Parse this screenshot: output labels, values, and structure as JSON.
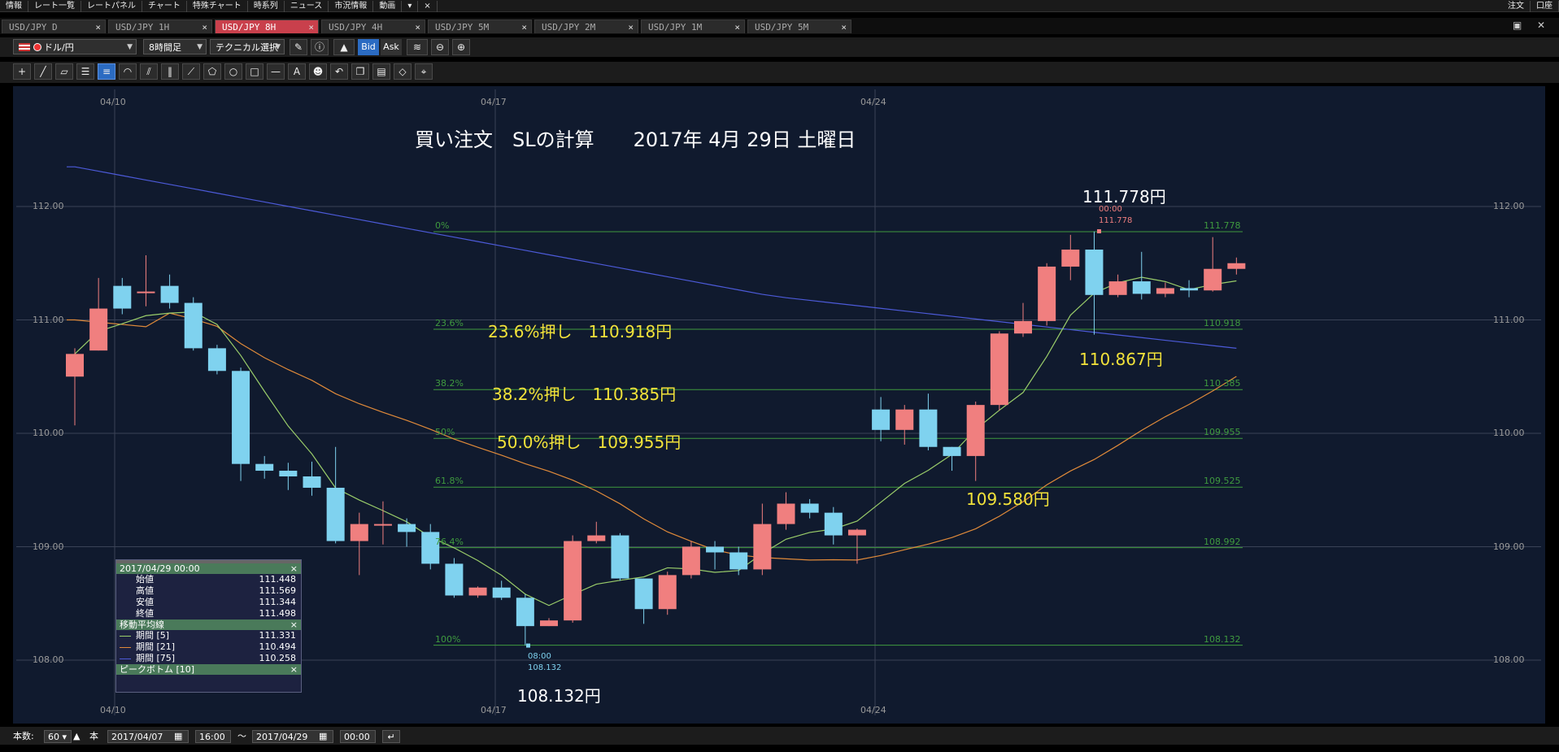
{
  "menu": {
    "items": [
      "情報",
      "レート一覧",
      "レートパネル",
      "チャート",
      "特殊チャート",
      "時系列",
      "ニュース",
      "市況情報",
      "動画"
    ],
    "more": "▾",
    "close": "×",
    "right_order": "注文",
    "right_account": "口座"
  },
  "tabs": [
    {
      "label": "USD/JPY D",
      "active": false
    },
    {
      "label": "USD/JPY 1H",
      "active": false
    },
    {
      "label": "USD/JPY 8H",
      "active": true
    },
    {
      "label": "USD/JPY 4H",
      "active": false
    },
    {
      "label": "USD/JPY 5M",
      "active": false
    },
    {
      "label": "USD/JPY 2M",
      "active": false
    },
    {
      "label": "USD/JPY 1M",
      "active": false
    },
    {
      "label": "USD/JPY 5M",
      "active": false
    }
  ],
  "tab_close": "×",
  "toolbar": {
    "pair": "ドル/円",
    "timeframe": "8時間足",
    "technical": "テクニカル選択",
    "bid": "Bid",
    "ask": "Ask"
  },
  "drawing_tools": [
    "cursor-cross",
    "trend-line",
    "ruler",
    "horizontal-lines",
    "channel",
    "fibonacci-arc",
    "fan",
    "vertical-lines",
    "gann",
    "pentagon",
    "circle",
    "rectangle",
    "horizontal-line",
    "text",
    "icon",
    "undo",
    "copy",
    "paste",
    "eraser",
    "measure"
  ],
  "chart": {
    "title": "買い注文　SLの計算　　2017年 4月 29日 土曜日",
    "y_axis_labels": [
      "112.00",
      "111.00",
      "110.00",
      "109.00",
      "108.00"
    ],
    "x_axis_labels": [
      "04/10",
      "04/17",
      "04/24"
    ],
    "fib_levels": [
      {
        "pct": "0%",
        "value": "111.778"
      },
      {
        "pct": "23.6%",
        "value": "110.918"
      },
      {
        "pct": "38.2%",
        "value": "110.385"
      },
      {
        "pct": "50%",
        "value": "109.955"
      },
      {
        "pct": "61.8%",
        "value": "109.525"
      },
      {
        "pct": "76.4%",
        "value": "108.992"
      },
      {
        "pct": "100%",
        "value": "108.132"
      }
    ],
    "annotations": {
      "fib236": "23.6%押し　110.918円",
      "fib382": "38.2%押し　110.385円",
      "fib500": "50.0%押し　109.955円",
      "high": "111.778円",
      "low": "108.132円",
      "a110867": "110.867円",
      "a109580": "109.580円"
    },
    "peak_marker": {
      "time": "00:00",
      "value": "111.778"
    },
    "bottom_marker": {
      "time": "08:00",
      "value": "108.132"
    },
    "colors": {
      "up": "#f07f7f",
      "down": "#7fd2ef",
      "ma5": "#9acd6a",
      "ma21": "#e08a3a",
      "ma75": "#4c5ad8",
      "fib": "#3f9a3f",
      "background": "#101a2e"
    }
  },
  "chart_data": {
    "type": "candlestick",
    "timeframe": "8H",
    "x_range": [
      "04/10",
      "04/28"
    ],
    "ylim": [
      107.75,
      112.75
    ],
    "candles": [
      [
        110.5,
        110.7,
        110.07,
        110.75
      ],
      [
        110.73,
        111.1,
        110.73,
        111.37
      ],
      [
        111.3,
        111.1,
        111.05,
        111.37
      ],
      [
        111.25,
        111.25,
        111.12,
        111.57
      ],
      [
        111.3,
        111.15,
        111.1,
        111.4
      ],
      [
        111.15,
        110.75,
        110.73,
        111.2
      ],
      [
        110.75,
        110.55,
        110.52,
        110.78
      ],
      [
        110.55,
        109.73,
        109.58,
        110.58
      ],
      [
        109.73,
        109.67,
        109.6,
        109.8
      ],
      [
        109.67,
        109.62,
        109.5,
        109.74
      ],
      [
        109.62,
        109.52,
        109.45,
        109.75
      ],
      [
        109.52,
        109.05,
        109.03,
        109.88
      ],
      [
        109.05,
        109.2,
        108.75,
        109.3
      ],
      [
        109.2,
        109.2,
        109.02,
        109.4
      ],
      [
        109.2,
        109.13,
        109.0,
        109.25
      ],
      [
        109.13,
        108.85,
        108.8,
        109.2
      ],
      [
        108.85,
        108.57,
        108.55,
        108.9
      ],
      [
        108.57,
        108.64,
        108.55,
        108.65
      ],
      [
        108.64,
        108.55,
        108.53,
        108.7
      ],
      [
        108.55,
        108.3,
        108.13,
        108.58
      ],
      [
        108.3,
        108.35,
        108.3,
        108.37
      ],
      [
        108.35,
        109.05,
        108.33,
        109.1
      ],
      [
        109.05,
        109.1,
        109.03,
        109.22
      ],
      [
        109.1,
        108.72,
        108.7,
        109.12
      ],
      [
        108.72,
        108.45,
        108.32,
        108.72
      ],
      [
        108.45,
        108.75,
        108.4,
        108.78
      ],
      [
        108.75,
        109.0,
        108.72,
        109.05
      ],
      [
        109.0,
        108.95,
        108.8,
        109.05
      ],
      [
        108.95,
        108.8,
        108.75,
        109.0
      ],
      [
        108.8,
        109.2,
        108.75,
        109.38
      ],
      [
        109.2,
        109.38,
        109.15,
        109.48
      ],
      [
        109.38,
        109.3,
        109.25,
        109.42
      ],
      [
        109.3,
        109.1,
        109.02,
        109.35
      ],
      [
        109.1,
        109.15,
        108.85,
        109.16
      ],
      [
        110.21,
        110.03,
        109.93,
        110.32
      ],
      [
        110.03,
        110.21,
        109.9,
        110.25
      ],
      [
        110.21,
        109.88,
        109.85,
        110.35
      ],
      [
        109.88,
        109.8,
        109.67,
        109.88
      ],
      [
        109.8,
        110.25,
        109.58,
        110.28
      ],
      [
        110.25,
        110.88,
        110.2,
        110.9
      ],
      [
        110.88,
        110.99,
        110.85,
        111.15
      ],
      [
        110.99,
        111.47,
        110.95,
        111.5
      ],
      [
        111.47,
        111.62,
        111.35,
        111.75
      ],
      [
        111.62,
        111.22,
        110.87,
        111.78
      ],
      [
        111.22,
        111.34,
        111.2,
        111.4
      ],
      [
        111.34,
        111.23,
        111.18,
        111.6
      ],
      [
        111.23,
        111.28,
        111.2,
        111.33
      ],
      [
        111.28,
        111.26,
        111.2,
        111.35
      ],
      [
        111.26,
        111.45,
        111.25,
        111.73
      ],
      [
        111.45,
        111.5,
        111.4,
        111.55
      ]
    ],
    "ohlc_order": [
      "open",
      "close",
      "low",
      "high"
    ],
    "fibonacci": {
      "high": 111.778,
      "low": 108.132,
      "levels": [
        0,
        23.6,
        38.2,
        50,
        61.8,
        76.4,
        100
      ],
      "values": [
        111.778,
        110.918,
        110.385,
        109.955,
        109.525,
        108.992,
        108.132
      ]
    },
    "moving_averages": [
      {
        "name": "期間 [5]",
        "value": 111.331
      },
      {
        "name": "期間 [21]",
        "value": 110.494
      },
      {
        "name": "期間 [75]",
        "value": 110.258
      }
    ]
  },
  "info_panel": {
    "timestamp": "2017/04/29 00:00",
    "rows": [
      {
        "label": "始値",
        "value": "111.448"
      },
      {
        "label": "高値",
        "value": "111.569"
      },
      {
        "label": "安値",
        "value": "111.344"
      },
      {
        "label": "終値",
        "value": "111.498"
      }
    ],
    "ma_header": "移動平均線",
    "ma_rows": [
      {
        "label": "期間 [5]",
        "value": "111.331"
      },
      {
        "label": "期間 [21]",
        "value": "110.494"
      },
      {
        "label": "期間 [75]",
        "value": "110.258"
      }
    ],
    "peak_header": "ピークボトム [10]",
    "close": "×"
  },
  "statusbar": {
    "count_label": "本数:",
    "count_value": "60",
    "unit": "本",
    "from_date": "2017/04/07",
    "from_time": "16:00",
    "tilde": "〜",
    "to_date": "2017/04/29",
    "to_time": "00:00"
  }
}
